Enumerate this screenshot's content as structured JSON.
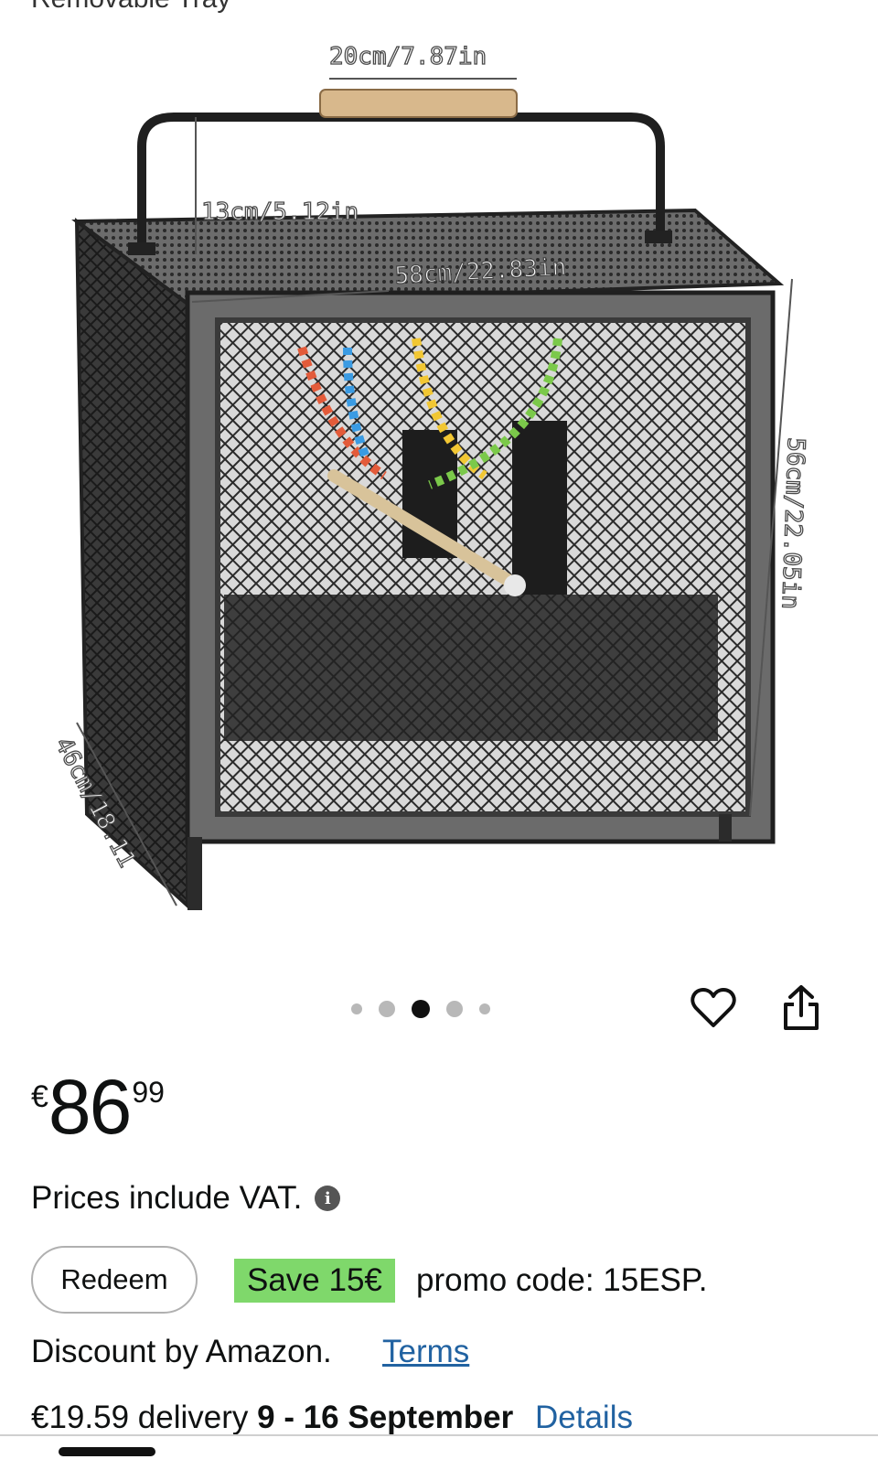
{
  "header": {
    "cut_title": "Removable Tray"
  },
  "gallery": {
    "dimensions": {
      "handle_width": "20cm/7.87in",
      "handle_height": "13cm/5.12in",
      "width": "58cm/22.83in",
      "height": "56cm/22.05in",
      "depth": "46cm/18.11"
    },
    "carousel": {
      "count": 5,
      "active_index": 2
    },
    "icons": {
      "wishlist": "heart-icon",
      "share": "share-icon"
    }
  },
  "price": {
    "currency": "€",
    "whole": "86",
    "fraction": "99"
  },
  "vat": {
    "text": "Prices include VAT.",
    "icon": "info-icon"
  },
  "promo": {
    "button_label": "Redeem",
    "badge": "Save 15€",
    "code_text": "promo code: 15ESP.",
    "badge_color": "#7fd86b"
  },
  "discount": {
    "text": "Discount by Amazon.",
    "terms_label": "Terms"
  },
  "delivery": {
    "price": "€19.59 delivery",
    "dates": "9 - 16 September",
    "details_label": "Details"
  },
  "colors": {
    "link": "#2162a1"
  }
}
